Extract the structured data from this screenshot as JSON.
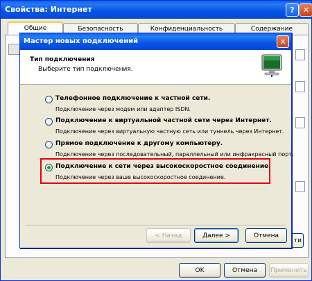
{
  "outer": {
    "title": "Свойства: Интернет",
    "title_buttons": {
      "help": "?",
      "close": "✕"
    },
    "tabs": [
      "Общие",
      "Безопасность",
      "Конфиденциальность",
      "Содержание"
    ],
    "buttons": {
      "ok": "OK",
      "cancel": "Отмена",
      "apply": "Применить"
    },
    "page_fragment_labels": {
      "side_button": "ти"
    }
  },
  "wizard": {
    "title": "Мастер новых подключений",
    "close": "✕",
    "header": {
      "title": "Тип подключения",
      "subtitle": "Выберите тип подключения."
    },
    "options": [
      {
        "label": "Телефонное подключение к частной сети.",
        "description": "Подключение через модем или адаптер ISDN.",
        "selected": false
      },
      {
        "label": "Подключение к виртуальной частной сети через Интернет.",
        "description": "Подключение через виртуальную частную сеть или туннель через Интернет.",
        "selected": false
      },
      {
        "label": "Прямое подключение к другому компьютеру.",
        "description": "Подключение через последовательный, параллельный или инфракрасный порт.",
        "selected": false
      },
      {
        "label": "Подключение к сети через высокоскоростное соединение",
        "description": "Подключение через ваше высокоскоростное соединение.",
        "selected": true
      }
    ],
    "buttons": {
      "back": "< Назад",
      "next": "Далее >",
      "cancel": "Отмена"
    },
    "highlight_color": "#e4000f"
  },
  "colors": {
    "titlebar": "#0758e8",
    "dialog_face": "#ece9d8",
    "radio_dot": "#21a121"
  },
  "icons": [
    "help-icon",
    "close-icon",
    "monitor-network-icon"
  ]
}
